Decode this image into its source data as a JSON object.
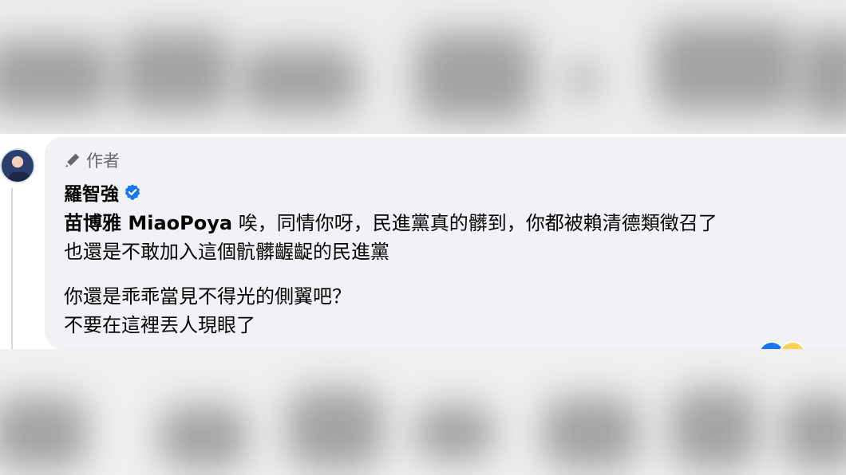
{
  "comment": {
    "author_badge": "作者",
    "author_name": "羅智強",
    "mention": "苗博雅 MiaoPoya",
    "line1_rest": " 唉，同情你呀，民進黨真的髒到，你都被賴清德類徵召了",
    "line2": "也還是不敢加入這個骯髒齷齪的民進黨",
    "line3": "你還是乖乖當見不得光的側翼吧？",
    "line4": "不要在這裡丟人現眼了"
  },
  "colors": {
    "bubble": "#f0f2f5",
    "verified": "#1877f2",
    "meta": "#65676b"
  }
}
